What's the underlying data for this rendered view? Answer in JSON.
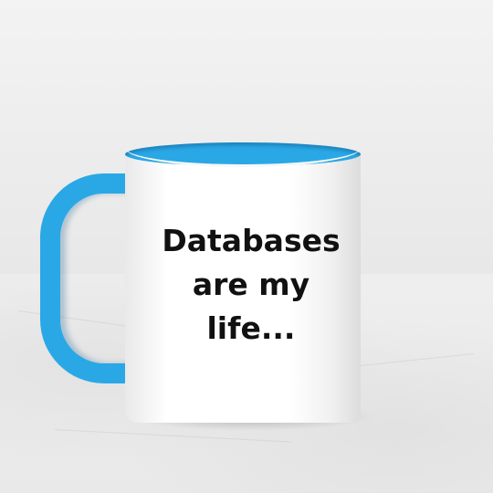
{
  "mug": {
    "line1": "Databases",
    "line2": "are my life..."
  },
  "colors": {
    "mug_accent": "#2aa8e6",
    "mug_body": "#ffffff",
    "text": "#111111"
  }
}
